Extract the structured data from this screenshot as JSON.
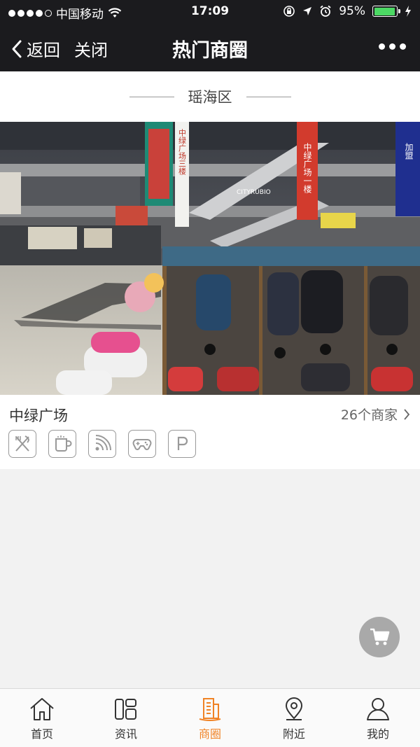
{
  "status_bar": {
    "carrier": "中国移动",
    "time": "17:09",
    "battery_percent": "95%",
    "battery_level": 0.95
  },
  "nav": {
    "back_label": "返回",
    "close_label": "关闭",
    "title": "热门商圈"
  },
  "district": {
    "name": "瑶海区"
  },
  "plaza": {
    "name": "中绿广场",
    "merchant_count": "26个商家",
    "photo_signs": [
      "CITYRUBIO",
      "中绿广场一楼",
      "加盟",
      "中绿广场三楼"
    ],
    "amenities": [
      "restaurant-icon",
      "coffee-icon",
      "wifi-icon",
      "game-icon",
      "parking-icon"
    ]
  },
  "tabbar": {
    "items": [
      {
        "label": "首页",
        "icon": "home-icon"
      },
      {
        "label": "资讯",
        "icon": "news-icon"
      },
      {
        "label": "商圈",
        "icon": "business-district-icon"
      },
      {
        "label": "附近",
        "icon": "location-icon"
      },
      {
        "label": "我的",
        "icon": "user-icon"
      }
    ],
    "active_index": 2
  },
  "colors": {
    "accent": "#f08325",
    "topbar": "#1b1b1e",
    "battery": "#4cd964"
  }
}
